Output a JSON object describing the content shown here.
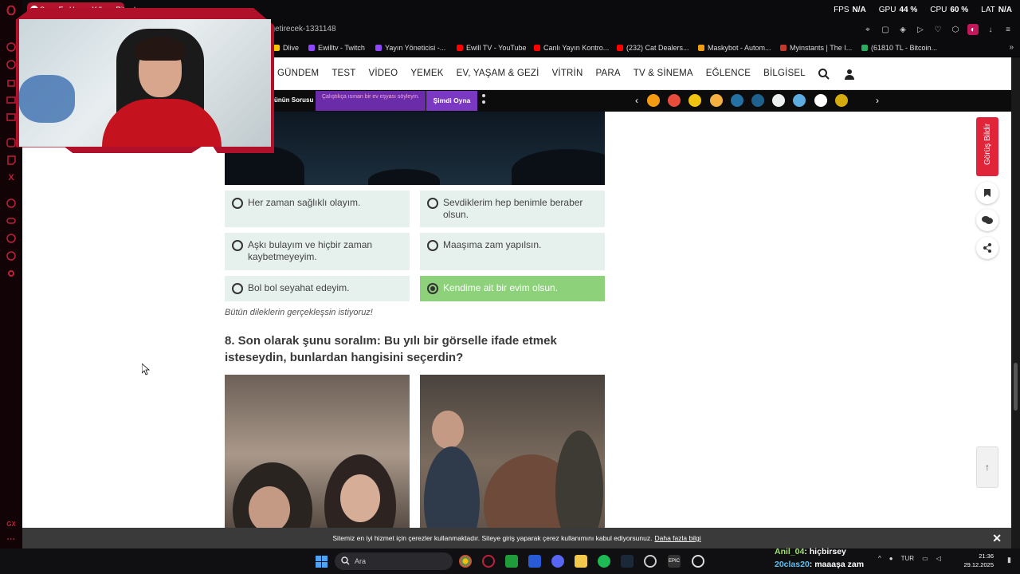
{
  "browser": {
    "tab_title": "Sana En Uygun Yılbaşı Riti",
    "new_tab": "+",
    "stats": {
      "fps_label": "FPS",
      "fps": "N/A",
      "gpu_label": "GPU",
      "gpu": "44 %",
      "cpu_label": "CPU",
      "cpu": "60 %",
      "lat_label": "LAT",
      "lat": "N/A"
    },
    "url": "ans-getirecek-1331148",
    "bookmarks": [
      {
        "label": "Dlive",
        "color": "#f7c600"
      },
      {
        "label": "Ewilltv - Twitch",
        "color": "#9146ff"
      },
      {
        "label": "Yayın Yöneticisi -...",
        "color": "#9146ff"
      },
      {
        "label": "Ewill TV - YouTube",
        "color": "#ff0000"
      },
      {
        "label": "Canlı Yayın Kontro...",
        "color": "#ff0000"
      },
      {
        "label": "(232) Cat Dealers...",
        "color": "#ff0000"
      },
      {
        "label": "Maskybot - Autom...",
        "color": "#f39c12"
      },
      {
        "label": "Myinstants | The I...",
        "color": "#c0392b"
      },
      {
        "label": "(61810 TL - Bitcoin...",
        "color": "#27ae60"
      }
    ]
  },
  "site": {
    "nav": [
      "GÜNDEM",
      "TEST",
      "VİDEO",
      "YEMEK",
      "EV, YAŞAM & GEZİ",
      "VİTRİN",
      "PARA",
      "TV & SİNEMA",
      "EĞLENCE",
      "BİLGİSEL"
    ],
    "promo": {
      "question": "ünün Sorusu",
      "text": "Çalıştıkça ısınan bir ev eşyası söyleyin.",
      "button": "Şimdi Oyna"
    },
    "reaction_colors": [
      "#f39c12",
      "#e74c3c",
      "#f1c40f",
      "#f5b041",
      "#2471a3",
      "#1f618d",
      "#ecf0f1",
      "#5dade2",
      "#ffffff",
      "#d4ac0d"
    ],
    "options": [
      {
        "label": "Her zaman sağlıklı olayım.",
        "selected": false
      },
      {
        "label": "Sevdiklerim hep benimle beraber olsun.",
        "selected": false
      },
      {
        "label": "Aşkı bulayım ve hiçbir zaman kaybetmeyeyim.",
        "selected": false
      },
      {
        "label": "Maaşıma zam yapılsın.",
        "selected": false
      },
      {
        "label": "Bol bol seyahat edeyim.",
        "selected": false
      },
      {
        "label": "Kendime ait bir evim olsun.",
        "selected": true
      }
    ],
    "result": "Bütün dileklerin gerçekleşsin istiyoruz!",
    "question": "8. Son olarak şunu soralım: Bu yılı bir görselle ifade etmek isteseydin, bunlardan hangisini seçerdin?",
    "feedback": "Görüş Bildir",
    "to_top": "↑",
    "cookie": {
      "text": "Sitemiz en iyi hizmet için çerezler kullanmaktadır. Siteye giriş yaparak çerez kullanımını kabul ediyorsunuz.",
      "link": "Daha fazla bilgi",
      "close": "✕"
    }
  },
  "taskbar": {
    "search": "Ara",
    "chat": [
      {
        "user": "Anil_04",
        "msg": ": hiçbirsey"
      },
      {
        "user": "20clas20",
        "msg": ": maaaşa zam"
      }
    ],
    "lang": "TUR",
    "time": "21:36",
    "date": "29.12.2025"
  }
}
